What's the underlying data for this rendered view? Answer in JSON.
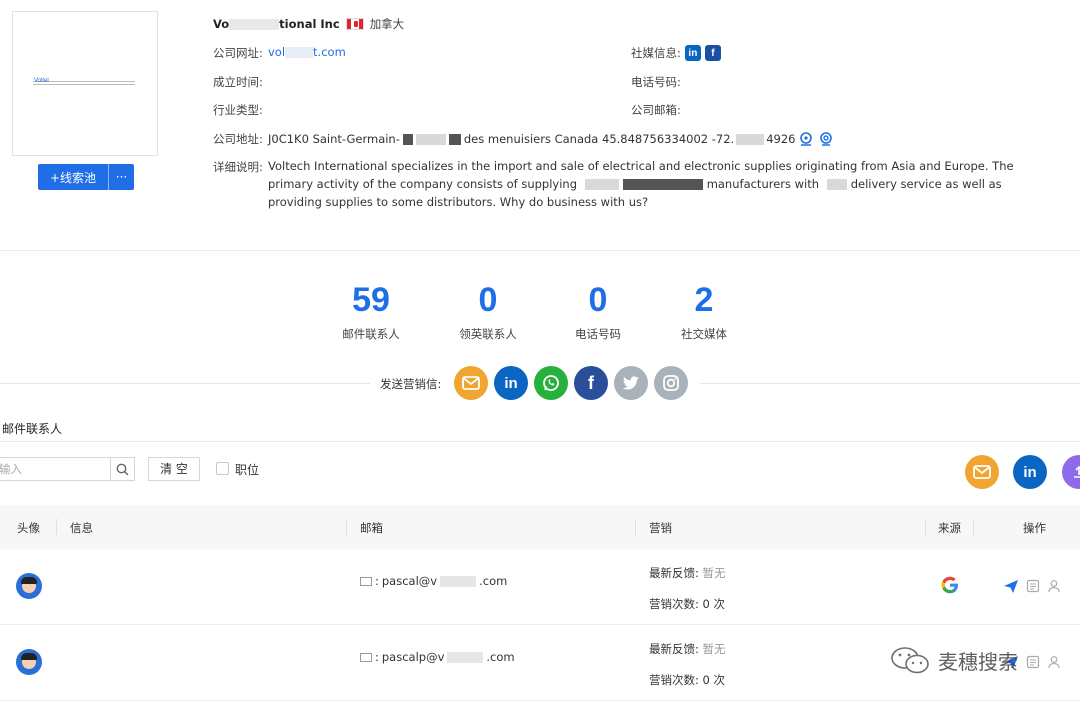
{
  "company": {
    "name_prefix": "Vo",
    "name_suffix": "tional Inc",
    "country": "加拿大",
    "website_label": "公司网址:",
    "website_prefix": "vol",
    "website_suffix": "t.com",
    "founded_label": "成立时间:",
    "industry_label": "行业类型:",
    "address_label": "公司地址:",
    "address_start": "J0C1K0 Saint-Germain-",
    "address_mid": "des menuisiers Canada 45.848756334002 -72.",
    "address_end": "4926",
    "social_label": "社媒信息:",
    "phone_label": "电话号码:",
    "email_label": "公司邮箱:",
    "desc_label": "详细说明:",
    "desc_part1": "Voltech International specializes in the import and sale of electrical and electronic supplies originating from Asia and Europe. The primary activity of the company consists of supplying",
    "desc_part2": "manufacturers with",
    "desc_part3": "delivery service as well as providing supplies to some distributors. Why do business with us?",
    "logo_text": "Voltel"
  },
  "lead_button": {
    "label": "+线索池",
    "more": "···"
  },
  "stats": [
    {
      "value": "59",
      "label": "邮件联系人"
    },
    {
      "value": "0",
      "label": "领英联系人"
    },
    {
      "value": "0",
      "label": "电话号码"
    },
    {
      "value": "2",
      "label": "社交媒体"
    }
  ],
  "send": {
    "label": "发送营销信:",
    "channels": [
      {
        "icon": "email-icon",
        "color": "#f0a531"
      },
      {
        "icon": "linkedin-icon",
        "color": "#0a66c2"
      },
      {
        "icon": "whatsapp-icon",
        "color": "#25b13c"
      },
      {
        "icon": "facebook-icon",
        "color": "#2a4f9a"
      },
      {
        "icon": "twitter-icon",
        "color": "#a9b1ba"
      },
      {
        "icon": "instagram-icon",
        "color": "#a9b1ba"
      }
    ]
  },
  "contacts": {
    "title": "邮件联系人",
    "search_placeholder": "输入",
    "clear_label": "清 空",
    "position_label": "职位",
    "headers": {
      "avatar": "头像",
      "info": "信息",
      "email": "邮箱",
      "marketing": "营销",
      "source": "来源",
      "actions": "操作"
    },
    "rows": [
      {
        "email_prefix": "pascal@v",
        "email_suffix": ".com",
        "feedback_label": "最新反馈:",
        "feedback_value": "暂无",
        "count_label": "营销次数:",
        "count_value": "0 次"
      },
      {
        "email_prefix": "pascalp@v",
        "email_suffix": ".com",
        "feedback_label": "最新反馈:",
        "feedback_value": "暂无",
        "count_label": "营销次数:",
        "count_value": "0 次"
      }
    ]
  },
  "watermark": "麦穗搜索",
  "colors": {
    "accent": "#1f6ee6",
    "orange": "#f0a531",
    "linkedin": "#0a66c2"
  }
}
